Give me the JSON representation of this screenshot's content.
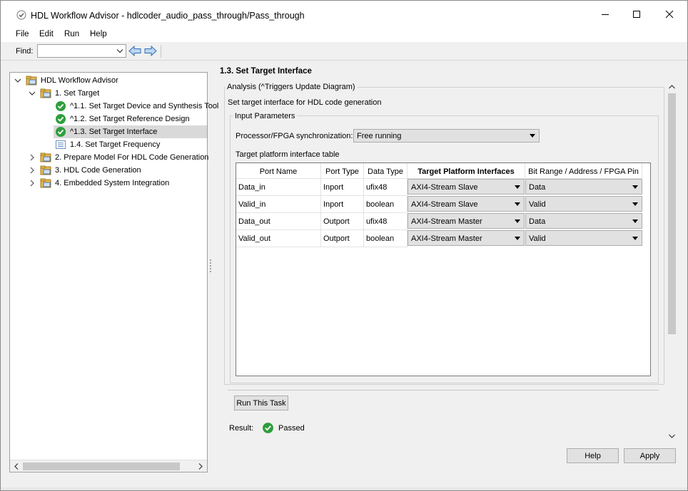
{
  "window": {
    "title": "HDL Workflow Advisor - hdlcoder_audio_pass_through/Pass_through"
  },
  "menu": {
    "items": [
      "File",
      "Edit",
      "Run",
      "Help"
    ]
  },
  "find": {
    "label": "Find:",
    "value": ""
  },
  "tree": {
    "items": [
      {
        "label": "HDL Workflow Advisor",
        "icon": "folder-advisor-icon",
        "expanded": true
      },
      {
        "label": "1. Set Target",
        "icon": "folder-advisor-icon",
        "expanded": true
      },
      {
        "label": "^1.1. Set Target Device and Synthesis Tool",
        "icon": "passed-check-icon"
      },
      {
        "label": "^1.2. Set Target Reference Design",
        "icon": "passed-check-icon"
      },
      {
        "label": "^1.3. Set Target Interface",
        "icon": "passed-check-icon",
        "selected": true
      },
      {
        "label": "1.4. Set Target Frequency",
        "icon": "task-list-icon"
      },
      {
        "label": "2. Prepare Model For HDL Code Generation",
        "icon": "folder-advisor-icon",
        "expanded": false
      },
      {
        "label": "3. HDL Code Generation",
        "icon": "folder-advisor-icon",
        "expanded": false
      },
      {
        "label": "4. Embedded System Integration",
        "icon": "folder-advisor-icon",
        "expanded": false
      }
    ]
  },
  "task": {
    "title": "1.3. Set Target Interface",
    "analysis_legend": "Analysis (^Triggers Update Diagram)",
    "description": "Set target interface for HDL code generation",
    "input_legend": "Input Parameters",
    "sync_label": "Processor/FPGA synchronization:",
    "sync_value": "Free running",
    "table_caption": "Target platform interface table",
    "run_button": "Run This Task",
    "result_label": "Result:",
    "result_value": "Passed"
  },
  "table": {
    "headers": [
      "Port Name",
      "Port Type",
      "Data Type",
      "Target Platform Interfaces",
      "Bit Range / Address / FPGA Pin"
    ],
    "rows": [
      [
        "Data_in",
        "Inport",
        "ufix48",
        "AXI4-Stream Slave",
        "Data"
      ],
      [
        "Valid_in",
        "Inport",
        "boolean",
        "AXI4-Stream Slave",
        "Valid"
      ],
      [
        "Data_out",
        "Outport",
        "ufix48",
        "AXI4-Stream Master",
        "Data"
      ],
      [
        "Valid_out",
        "Outport",
        "boolean",
        "AXI4-Stream Master",
        "Valid"
      ]
    ]
  },
  "footer": {
    "help_button": "Help",
    "apply_button": "Apply"
  },
  "colors": {
    "selection": "#d9d9d9",
    "passed_green": "#2e9e3c",
    "folder_yellow": "#e8b84a"
  }
}
